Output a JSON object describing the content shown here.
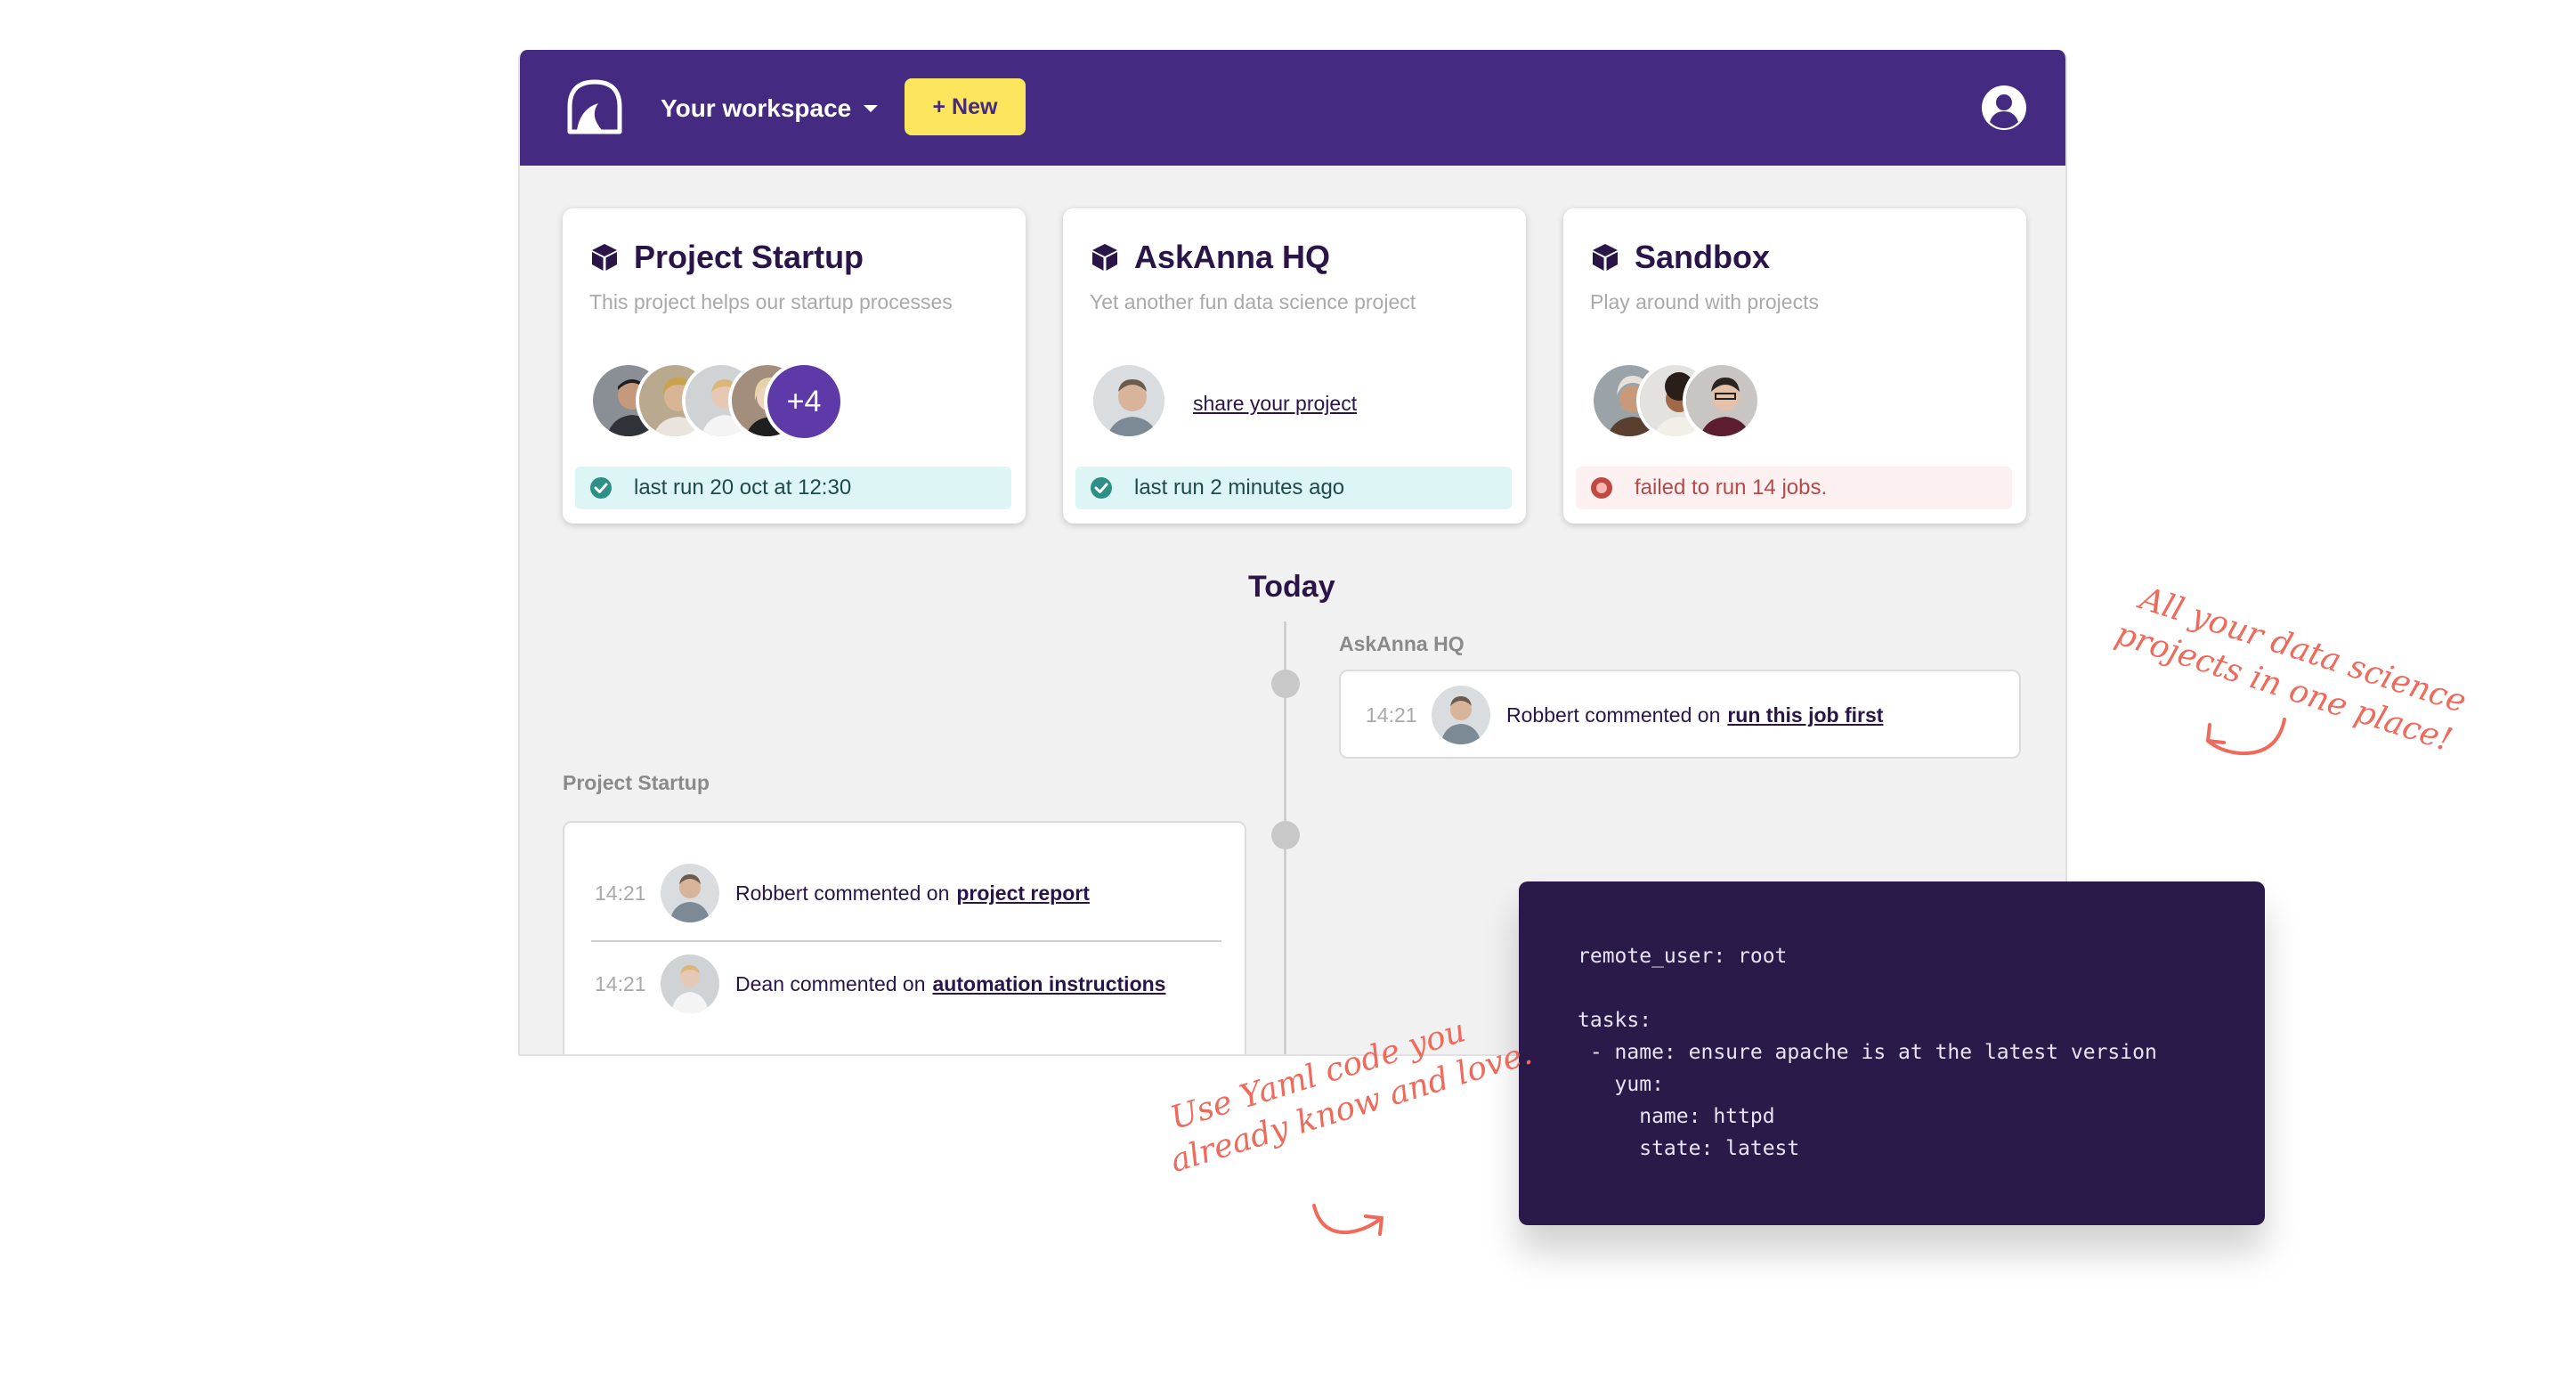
{
  "header": {
    "workspace_label": "Your workspace",
    "new_label": "+ New",
    "colors": {
      "bar": "#452a82",
      "new_button": "#fde55e"
    },
    "icons": {
      "logo": "askanna-logo-icon",
      "dropdown": "caret-down-icon",
      "user": "user-circle-icon"
    }
  },
  "projects": [
    {
      "title": "Project Startup",
      "description": "This project helps our startup processes",
      "members_more": "+4",
      "status": "last run 20 oct at 12:30",
      "status_type": "success"
    },
    {
      "title": "AskAnna HQ",
      "description": "Yet another fun data science project",
      "share_label": "share your project",
      "status": "last run 2 minutes ago",
      "status_type": "success"
    },
    {
      "title": "Sandbox",
      "description": "Play around with projects",
      "status": "failed to run 14 jobs.",
      "status_type": "error"
    }
  ],
  "timeline": {
    "heading": "Today",
    "groups": [
      {
        "project": "AskAnna HQ",
        "entries": [
          {
            "time": "14:21",
            "text": "Robbert commented on",
            "link": "run this job first"
          }
        ]
      },
      {
        "project": "Project Startup",
        "entries": [
          {
            "time": "14:21",
            "text": "Robbert commented on",
            "link": "project report"
          },
          {
            "time": "14:21",
            "text": "Dean commented on",
            "link": "automation instructions"
          }
        ]
      }
    ]
  },
  "code": {
    "lines": [
      "remote_user: root",
      "",
      "tasks:",
      " - name: ensure apache is at the latest version",
      "   yum:",
      "     name: httpd",
      "     state: latest"
    ]
  },
  "annotations": {
    "projects_note_line1": "All your data science",
    "projects_note_line2": "projects in one place!",
    "yaml_note_line1": "Use Yaml code you",
    "yaml_note_line2": "already know and love.",
    "color": "#f06a5c"
  }
}
